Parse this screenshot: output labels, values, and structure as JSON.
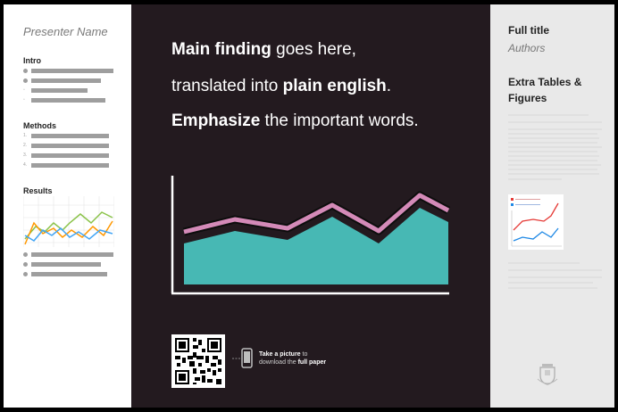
{
  "left": {
    "presenter": "Presenter Name",
    "intro_title": "Intro",
    "methods_title": "Methods",
    "methods_numbers": [
      "1.",
      "2.",
      "3.",
      "4."
    ],
    "results_title": "Results"
  },
  "center": {
    "line1_bold": "Main finding",
    "line1_rest": " goes here,",
    "line2_start": "translated into ",
    "line2_bold": "plain english",
    "line2_end": ".",
    "line3_bold": "Emphasize",
    "line3_rest": " the important words.",
    "cta_line1_bold": "Take a picture",
    "cta_line1_rest": " to",
    "cta_line2_start": "download the ",
    "cta_line2_bold": "full paper"
  },
  "right": {
    "full_title": "Full title",
    "authors": "Authors",
    "extra": "Extra Tables & Figures"
  },
  "colors": {
    "dark_bg": "#231a1f",
    "teal": "#47b8b4",
    "pink": "#d48ab8",
    "grey_bar": "#9e9e9e",
    "right_bg": "#e9e9e9"
  },
  "icons": [
    "phone-icon",
    "qr-code-icon",
    "university-seal-icon"
  ]
}
